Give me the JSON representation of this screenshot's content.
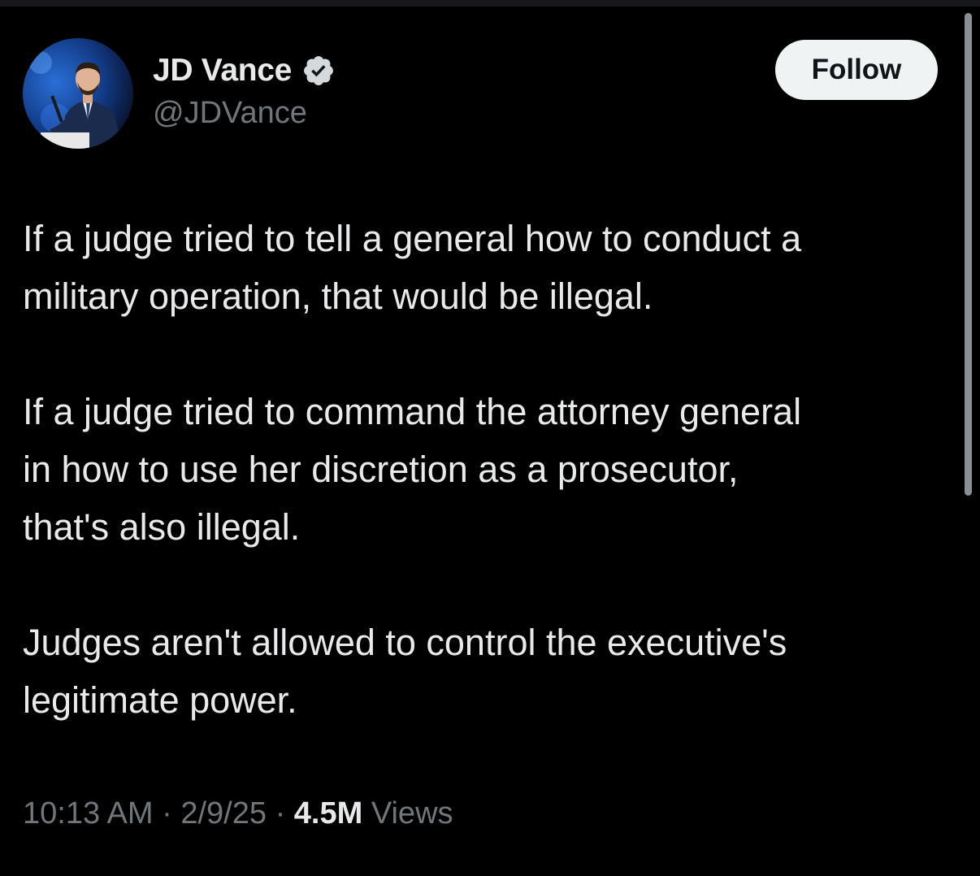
{
  "author": {
    "display_name": "JD Vance",
    "handle": "@JDVance",
    "verified": true,
    "verified_color": "#1d9bf0",
    "avatar_icon": "profile-photo"
  },
  "actions": {
    "follow_label": "Follow"
  },
  "tweet": {
    "paragraphs": [
      "If a judge tried to tell a general how to conduct a\nmilitary operation, that would be illegal.",
      "If a judge tried to command the attorney general\nin how to use her discretion as a prosecutor,\nthat's also illegal.",
      "Judges aren't allowed to control the executive's\nlegitimate power."
    ]
  },
  "meta": {
    "time": "10:13 AM",
    "separator": "·",
    "date": "2/9/25",
    "views_count": "4.5M",
    "views_label": "Views"
  },
  "colors": {
    "background": "#000000",
    "text_primary": "#e7e9ea",
    "text_secondary": "#71767b",
    "button_bg": "#eff3f4"
  }
}
